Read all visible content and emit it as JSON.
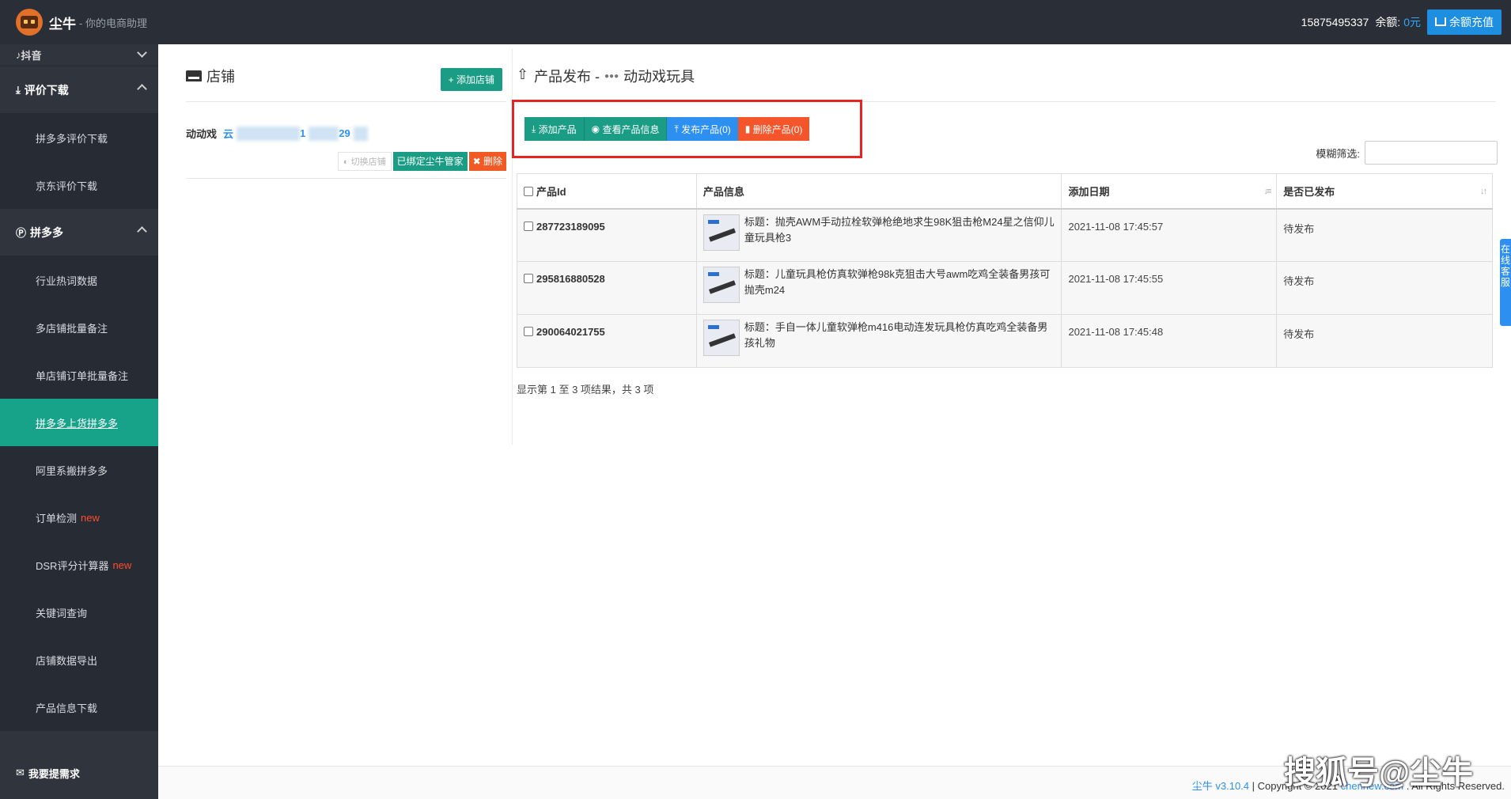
{
  "app": {
    "name": "尘牛",
    "subtitle": "- 你的电商助理"
  },
  "topbar": {
    "phone": "15875495337",
    "balance_label": "余额:",
    "balance_value": "0元",
    "recharge_label": "余额充值"
  },
  "sidebar": {
    "top_item": "抖音",
    "groups": [
      {
        "label": "评价下载",
        "items": [
          "拼多多评价下载",
          "京东评价下载"
        ]
      },
      {
        "label": "拼多多",
        "items": [
          "行业热词数据",
          "多店铺批量备注",
          "单店铺订单批量备注",
          "拼多多上货拼多多",
          "阿里系搬拼多多",
          "订单检测",
          "DSR评分计算器",
          "关键词查询",
          "店铺数据导出",
          "产品信息下载"
        ]
      }
    ],
    "new_badge": "new",
    "bottom_item": "我要提需求"
  },
  "shop_panel": {
    "title": "店铺",
    "add_button": "添加店铺",
    "shop": {
      "name": "动动戏",
      "id_prefix": "云",
      "id_mid": "1",
      "id_suffix": "29"
    },
    "switch_button": "切换店铺",
    "bound_button": "已绑定尘牛管家",
    "delete_button": "删除"
  },
  "product_panel": {
    "title": "产品发布 -",
    "shop_name": "动动戏玩具",
    "buttons": {
      "add": "添加产品",
      "view": "查看产品信息",
      "publish": "发布产品(0)",
      "delete": "删除产品(0)"
    },
    "filter_label": "模糊筛选:",
    "columns": [
      "产品Id",
      "产品信息",
      "添加日期",
      "是否已发布"
    ],
    "rows": [
      {
        "id": "287723189095",
        "info": "标题：抛壳AWM手动拉栓软弹枪绝地求生98K狙击枪M24星之信仰儿童玩具枪3",
        "date": "2021-11-08 17:45:57",
        "status": "待发布"
      },
      {
        "id": "295816880528",
        "info": "标题：儿童玩具枪仿真软弹枪98k克狙击大号awm吃鸡全装备男孩可抛壳m24",
        "date": "2021-11-08 17:45:55",
        "status": "待发布"
      },
      {
        "id": "290064021755",
        "info": "标题：手自一体儿童软弹枪m416电动连发玩具枪仿真吃鸡全装备男孩礼物",
        "date": "2021-11-08 17:45:48",
        "status": "待发布"
      }
    ],
    "result_info": "显示第 1 至 3 项结果，共 3 项"
  },
  "footer": {
    "brand": "尘牛 v3.10.4",
    "copyright": " | Copyright © 2021 ",
    "site": "chennew.com",
    "rights": " . All Rights Reserved."
  },
  "watermark": "搜狐号@尘牛",
  "side_tab": "在线客服"
}
